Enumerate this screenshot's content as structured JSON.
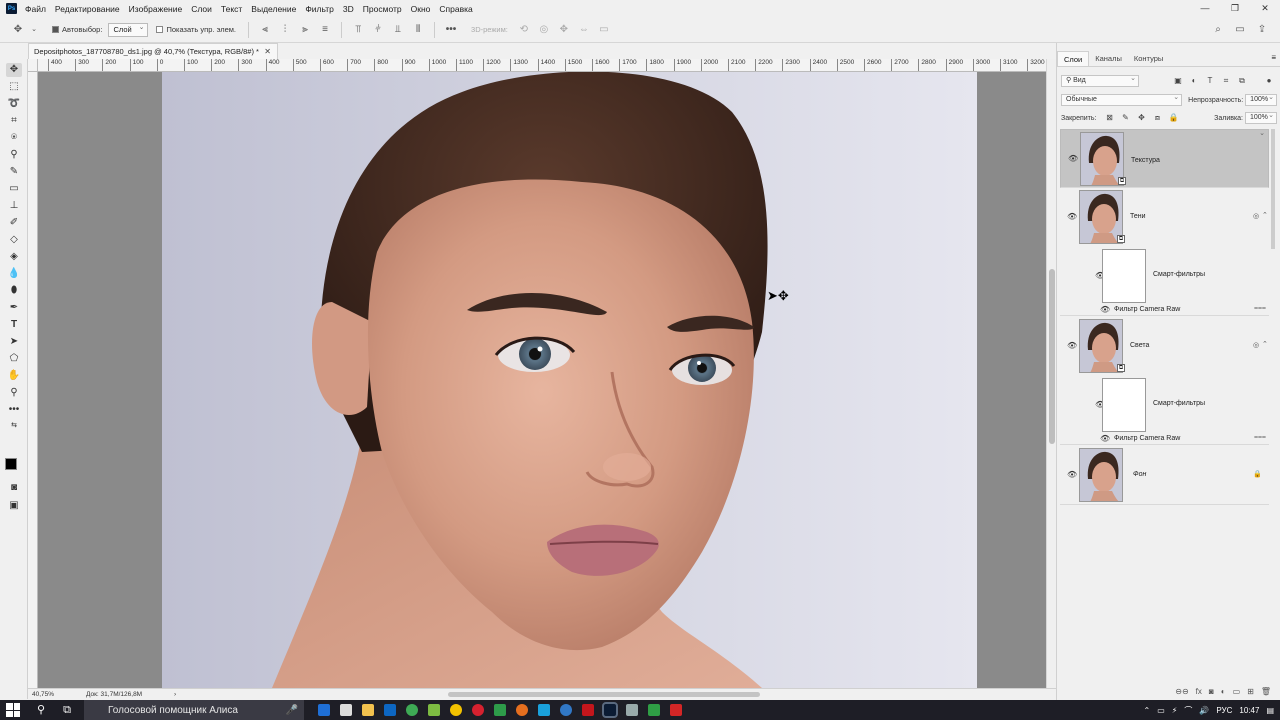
{
  "menu": {
    "items": [
      "Файл",
      "Редактирование",
      "Изображение",
      "Слои",
      "Текст",
      "Выделение",
      "Фильтр",
      "3D",
      "Просмотр",
      "Окно",
      "Справка"
    ],
    "app_icon": "Ps"
  },
  "options": {
    "autoselect_label": "Автовыбор:",
    "autoselect_value": "Слой",
    "show_controls_label": "Показать упр. элем.",
    "mode_3d_label": "3D-режим:"
  },
  "document": {
    "tab_title": "Depositphotos_187708780_ds1.jpg @ 40,7% (Текстура, RGB/8#) *"
  },
  "ruler": {
    "top_labels": [
      "400",
      "300",
      "200",
      "100",
      "0",
      "100",
      "200",
      "300",
      "400",
      "500",
      "600",
      "700",
      "800",
      "900",
      "1000",
      "1100",
      "1200",
      "1300",
      "1400",
      "1500",
      "1600",
      "1700",
      "1800",
      "1900",
      "2000",
      "2100",
      "2200",
      "2300",
      "2400",
      "2500",
      "2600",
      "2700",
      "2800",
      "2900",
      "3000",
      "3100",
      "3200"
    ]
  },
  "status": {
    "zoom": "40,75%",
    "doc_size": "Док: 31,7M/126,8M"
  },
  "panel": {
    "tabs": [
      "Слои",
      "Каналы",
      "Контуры"
    ],
    "filter_kind": "Вид",
    "blend_mode": "Обычные",
    "opacity_label": "Непрозрачность:",
    "opacity_value": "100%",
    "lock_label": "Закрепить:",
    "fill_label": "Заливка:",
    "fill_value": "100%",
    "layers": [
      {
        "name": "Текстура",
        "selected": true
      },
      {
        "name": "Тени",
        "smart_filters": "Смарт-фильтры",
        "filter": "Фильтр Camera Raw"
      },
      {
        "name": "Света",
        "smart_filters": "Смарт-фильтры",
        "filter": "Фильтр Camera Raw"
      },
      {
        "name": "Фон",
        "locked": true
      }
    ]
  },
  "taskbar": {
    "search_text": "Голосовой помощник Алиса",
    "language": "РУС",
    "time": "10:47"
  }
}
